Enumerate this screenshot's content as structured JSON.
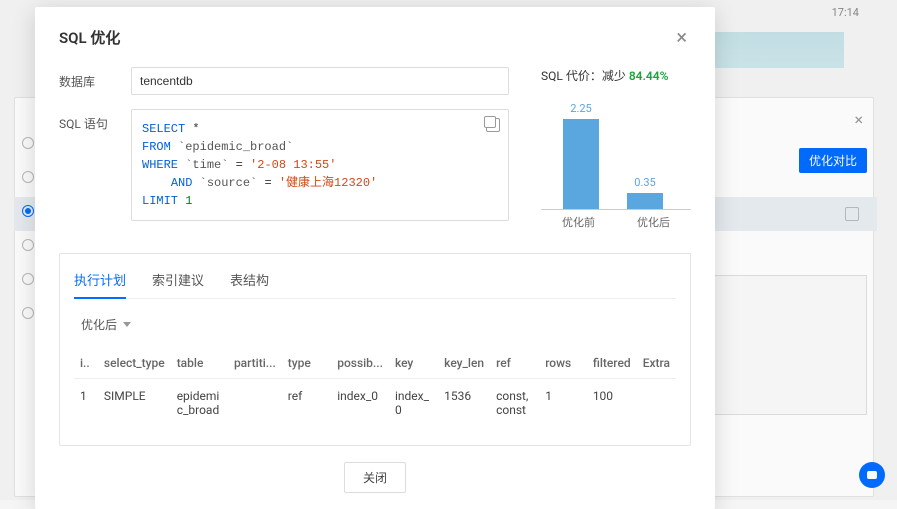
{
  "bg": {
    "time": "17:14",
    "compare_btn": "优化对比"
  },
  "modal": {
    "title": "SQL 优化",
    "close_label": "关闭",
    "db_label": "数据库",
    "db_value": "tencentdb",
    "sql_label": "SQL 语句"
  },
  "sql": {
    "select": "SELECT",
    "star": "*",
    "from": "FROM",
    "tbl": "`epidemic_broad`",
    "where": "WHERE",
    "col_time": "`time`",
    "eq": "=",
    "v_time": "'2-08 13:55'",
    "and": "AND",
    "col_src": "`source`",
    "v_src": "'健康上海12320'",
    "limit": "LIMIT",
    "lim_n": "1"
  },
  "cost": {
    "prefix": "SQL 代价：减少 ",
    "pct": "84.44%"
  },
  "chart_data": {
    "type": "bar",
    "categories": [
      "优化前",
      "优化后"
    ],
    "values": [
      2.25,
      0.35
    ],
    "title": "SQL 代价",
    "xlabel": "",
    "ylabel": "",
    "ylim": [
      0,
      2.5
    ]
  },
  "tabs": {
    "plan": "执行计划",
    "idx": "索引建议",
    "schema": "表结构"
  },
  "filter": {
    "after": "优化后"
  },
  "cols": {
    "id": "i..",
    "select_type": "select_type",
    "table": "table",
    "partitions": "partiti...",
    "type": "type",
    "possible": "possib...",
    "key": "key",
    "key_len": "key_len",
    "ref": "ref",
    "rows": "rows",
    "filtered": "filtered",
    "extra": "Extra"
  },
  "row": {
    "id": "1",
    "select_type": "SIMPLE",
    "table": "epidemic_broad",
    "partitions": "",
    "type": "ref",
    "possible": "index_0",
    "key": "index_0",
    "key_len": "1536",
    "ref": "const,const",
    "rows": "1",
    "filtered": "100",
    "extra": ""
  }
}
